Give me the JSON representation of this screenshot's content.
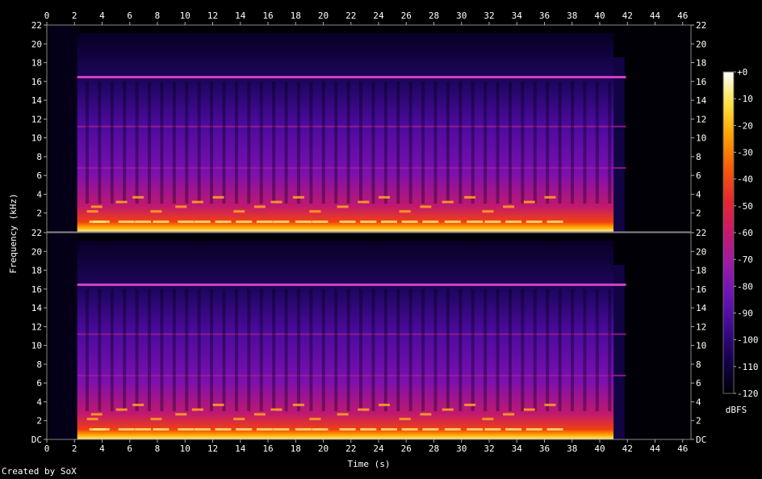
{
  "chart_data": {
    "type": "heatmap",
    "title": "",
    "xlabel": "Time (s)",
    "ylabel": "Frequency (kHz)",
    "xlim": [
      0,
      46.6
    ],
    "ylim": [
      0,
      22
    ],
    "x_ticks": [
      "0",
      "2",
      "4",
      "6",
      "8",
      "10",
      "12",
      "14",
      "16",
      "18",
      "20",
      "22",
      "24",
      "26",
      "28",
      "30",
      "32",
      "34",
      "36",
      "38",
      "40",
      "42",
      "44",
      "46"
    ],
    "y_ticks_top": [
      "22",
      "20",
      "18",
      "16",
      "14",
      "12",
      "10",
      "8",
      "6",
      "4",
      "2"
    ],
    "y_ticks_bottom": [
      "22",
      "20",
      "18",
      "16",
      "14",
      "12",
      "10",
      "8",
      "6",
      "4",
      "2",
      "DC"
    ],
    "channels": 2,
    "audio_start_s": 2.2,
    "audio_end_s": 41.0,
    "tone_lines_khz": [
      16.5,
      11.2,
      6.8
    ],
    "colorbar": {
      "label": "dBFS",
      "min": -120,
      "max": 0,
      "ticks": [
        "+0",
        "-10",
        "-20",
        "-30",
        "-40",
        "-50",
        "-60",
        "-70",
        "-80",
        "-90",
        "-100",
        "-110",
        "-120"
      ],
      "colors": [
        "#000000",
        "#14004a",
        "#3a0a8c",
        "#6a12b8",
        "#9a1aa8",
        "#c8186e",
        "#e8262c",
        "#f85a08",
        "#ffa000",
        "#ffe040",
        "#ffffff"
      ]
    }
  },
  "footer": {
    "credit": "Created by SoX"
  }
}
